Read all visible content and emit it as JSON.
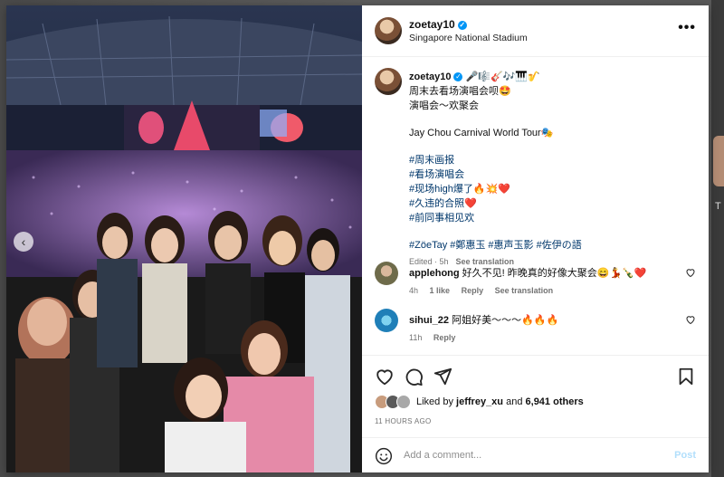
{
  "post": {
    "username": "zoetay10",
    "location": "Singapore National Stadium",
    "more_label": "•••"
  },
  "caption": {
    "username": "zoetay10",
    "emoji_line": "🎤🎼🎸🎶🎹🎷",
    "lines": [
      "周末去看场演唱会呗🤩",
      "演唱会～欢聚会"
    ],
    "tour": "Jay Chou Carnival World Tour🎭",
    "hashtags": [
      "#周末画报",
      "#看场演唱会",
      "#现场high爆了🔥💥❤️",
      "#久违的合照❤️",
      "#前同事相见欢"
    ],
    "tagline": "#ZöeTay #鄭惠玉 #惠声玉影 #佐伊の語",
    "edited": "Edited · 5h",
    "see_translation": "See translation"
  },
  "comments": [
    {
      "user": "applehong",
      "text": "好久不见! 昨晚真的好像大聚会😄💃🍾❤️",
      "age": "4h",
      "likes": "1 like",
      "reply": "Reply",
      "see_translation": "See translation"
    },
    {
      "user": "sihui_22",
      "text": "阿姐好美～～～🔥🔥🔥",
      "age": "11h",
      "reply": "Reply"
    }
  ],
  "likes": {
    "prefix": "Liked by",
    "user": "jeffrey_xu",
    "and": "and",
    "count": "6,941 others"
  },
  "timestamp": "11 HOURS AGO",
  "composer": {
    "placeholder": "Add a comment...",
    "post_label": "Post"
  },
  "background": {
    "right_letter": "T"
  },
  "colors": {
    "verified": "#0095f6",
    "link": "#00376b",
    "post_disabled": "#b2dffc"
  }
}
